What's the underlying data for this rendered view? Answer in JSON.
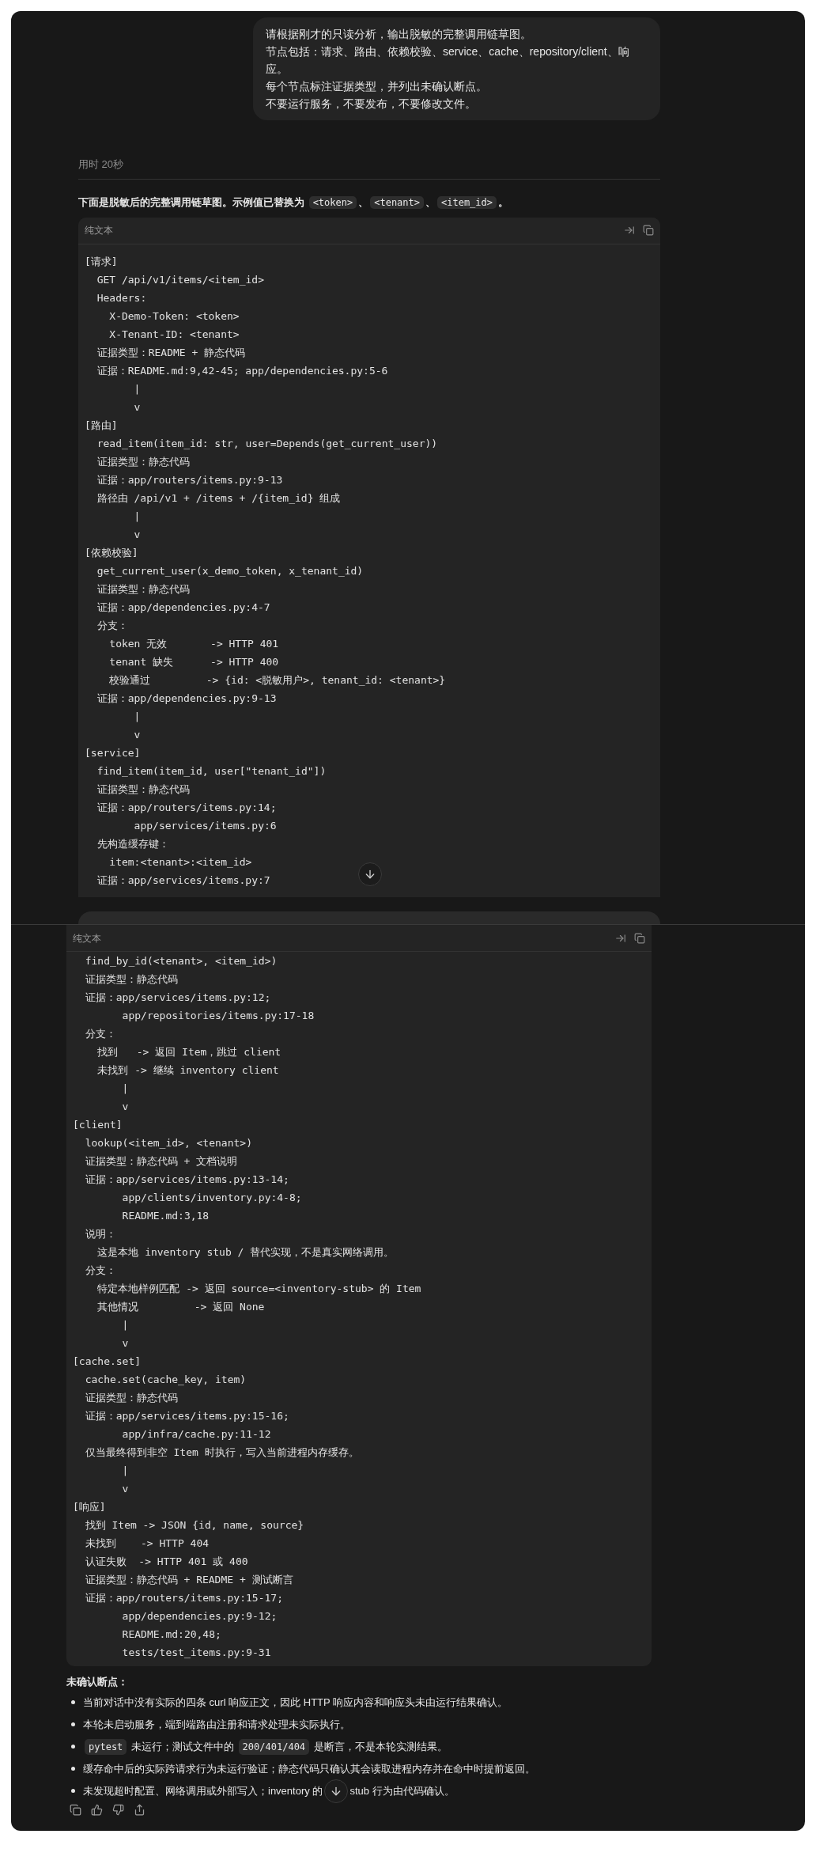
{
  "user_message": {
    "lines": [
      "请根据刚才的只读分析，输出脱敏的完整调用链草图。",
      "节点包括：请求、路由、依赖校验、service、cache、repository/client、响应。",
      "每个节点标注证据类型，并列出未确认断点。",
      "不要运行服务，不要发布，不要修改文件。"
    ]
  },
  "elapsed": "用时 20秒",
  "intro": [
    {
      "kind": "text",
      "text": "下面是脱敏后的完整调用链草图。示例值已替换为 "
    },
    {
      "kind": "code",
      "text": "<token>"
    },
    {
      "kind": "text",
      "text": "、"
    },
    {
      "kind": "code",
      "text": "<tenant>"
    },
    {
      "kind": "text",
      "text": "、"
    },
    {
      "kind": "code",
      "text": "<item_id>"
    },
    {
      "kind": "text",
      "text": "。"
    }
  ],
  "code_blocks": [
    {
      "label": "纯文本",
      "lines": [
        "[请求]",
        "  GET /api/v1/items/<item_id>",
        "  Headers:",
        "    X-Demo-Token: <token>",
        "    X-Tenant-ID: <tenant>",
        "  证据类型：README + 静态代码",
        "  证据：README.md:9,42-45; app/dependencies.py:5-6",
        "        |",
        "        v",
        "[路由]",
        "  read_item(item_id: str, user=Depends(get_current_user))",
        "  证据类型：静态代码",
        "  证据：app/routers/items.py:9-13",
        "  路径由 /api/v1 + /items + /{item_id} 组成",
        "        |",
        "        v",
        "[依赖校验]",
        "  get_current_user(x_demo_token, x_tenant_id)",
        "  证据类型：静态代码",
        "  证据：app/dependencies.py:4-7",
        "  分支：",
        "    token 无效       -> HTTP 401",
        "    tenant 缺失      -> HTTP 400",
        "    校验通过         -> {id: <脱敏用户>, tenant_id: <tenant>}",
        "  证据：app/dependencies.py:9-13",
        "        |",
        "        v",
        "[service]",
        "  find_item(item_id, user[\"tenant_id\"])",
        "  证据类型：静态代码",
        "  证据：app/routers/items.py:14;",
        "        app/services/items.py:6",
        "  先构造缓存键：",
        "    item:<tenant>:<item_id>",
        "  证据：app/services/items.py:7"
      ]
    },
    {
      "label": "纯文本",
      "lines": [
        "  find_by_id(<tenant>, <item_id>)",
        "  证据类型：静态代码",
        "  证据：app/services/items.py:12;",
        "        app/repositories/items.py:17-18",
        "  分支：",
        "    找到   -> 返回 Item，跳过 client",
        "    未找到 -> 继续 inventory client",
        "        |",
        "        v",
        "[client]",
        "  lookup(<item_id>, <tenant>)",
        "  证据类型：静态代码 + 文档说明",
        "  证据：app/services/items.py:13-14;",
        "        app/clients/inventory.py:4-8;",
        "        README.md:3,18",
        "  说明：",
        "    这是本地 inventory stub / 替代实现，不是真实网络调用。",
        "  分支：",
        "    特定本地样例匹配 -> 返回 source=<inventory-stub> 的 Item",
        "    其他情况         -> 返回 None",
        "        |",
        "        v",
        "[cache.set]",
        "  cache.set(cache_key, item)",
        "  证据类型：静态代码",
        "  证据：app/services/items.py:15-16;",
        "        app/infra/cache.py:11-12",
        "  仅当最终得到非空 Item 时执行，写入当前进程内存缓存。",
        "        |",
        "        v",
        "[响应]",
        "  找到 Item -> JSON {id, name, source}",
        "  未找到    -> HTTP 404",
        "  认证失败  -> HTTP 401 或 400",
        "  证据类型：静态代码 + README + 测试断言",
        "  证据：app/routers/items.py:15-17;",
        "        app/dependencies.py:9-12;",
        "        README.md:20,48;",
        "        tests/test_items.py:9-31"
      ]
    }
  ],
  "unconfirmed": {
    "heading": "未确认断点：",
    "items": [
      {
        "parts": [
          {
            "kind": "text",
            "text": "当前对话中没有实际的四条 curl 响应正文，因此 HTTP 响应内容和响应头未由运行结果确认。"
          }
        ]
      },
      {
        "parts": [
          {
            "kind": "text",
            "text": "本轮未启动服务，端到端路由注册和请求处理未实际执行。"
          }
        ]
      },
      {
        "parts": [
          {
            "kind": "code",
            "text": "pytest"
          },
          {
            "kind": "text",
            "text": " 未运行；测试文件中的 "
          },
          {
            "kind": "code",
            "text": "200/401/404"
          },
          {
            "kind": "text",
            "text": " 是断言，不是本轮实测结果。"
          }
        ]
      },
      {
        "parts": [
          {
            "kind": "text",
            "text": "缓存命中后的实际跨请求行为未运行验证；静态代码只确认其会读取进程内存并在命中时提前返回。"
          }
        ]
      },
      {
        "parts": [
          {
            "kind": "text",
            "text": "未发现超时配置、网络调用或外部写入；inventory 的"
          },
          {
            "kind": "scroll_button"
          },
          {
            "kind": "text",
            "text": "stub 行为由代码确认。"
          }
        ]
      }
    ]
  }
}
